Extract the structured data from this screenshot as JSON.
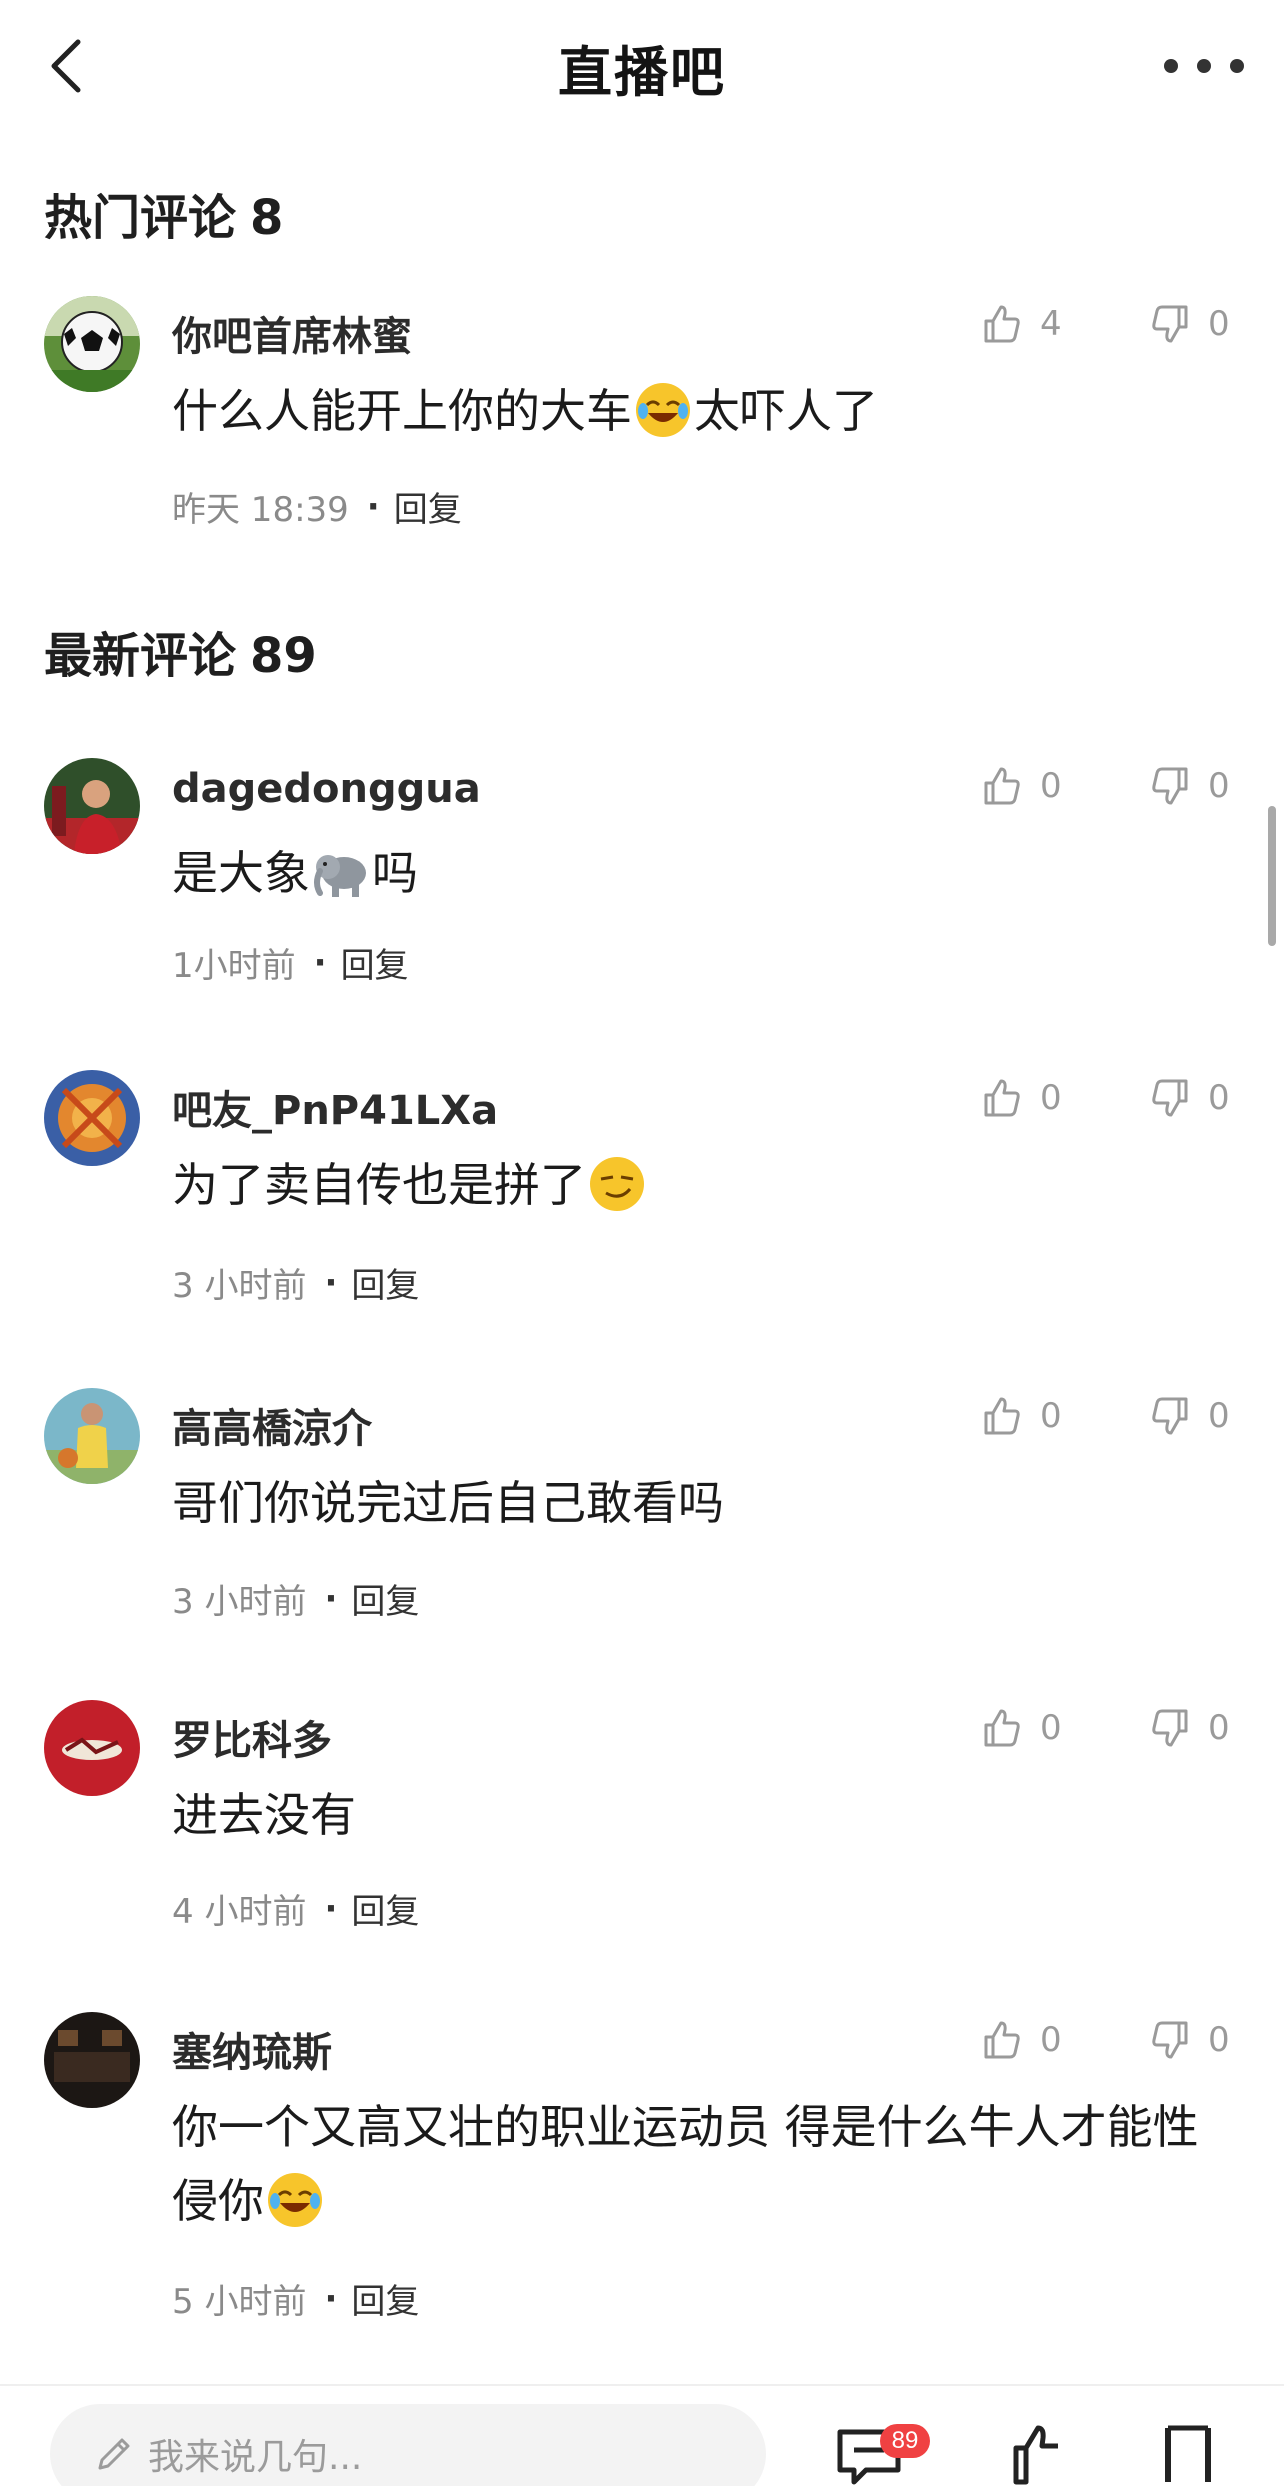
{
  "header": {
    "title": "直播吧",
    "back_icon": "chevron-left-icon",
    "more_icon": "more-dots-icon"
  },
  "hot_section": {
    "label": "热门评论",
    "count": "8"
  },
  "latest_section": {
    "label": "最新评论",
    "count": "89"
  },
  "hot_comments": [
    {
      "user": "你吧首席林蜜",
      "text_before": "什么人能开上你的大车",
      "emoji": "laugh-cry-emoji",
      "text_after": "太吓人了",
      "time": "昨天 18:39",
      "reply": "回复",
      "likes": "4",
      "dislikes": "0",
      "avatar": "soccer-ball-avatar"
    }
  ],
  "latest_comments": [
    {
      "user": "dagedonggua",
      "text_before": "是大象",
      "emoji": "elephant-emoji",
      "text_after": "吗",
      "time": "1小时前",
      "reply": "回复",
      "likes": "0",
      "dislikes": "0",
      "avatar": "player-red-avatar"
    },
    {
      "user": "吧友_PnP41LXa",
      "text_before": "为了卖自传也是拼了",
      "emoji": "smirk-emoji",
      "text_after": "",
      "time": "3 小时前",
      "reply": "回复",
      "likes": "0",
      "dislikes": "0",
      "avatar": "orange-abstract-avatar"
    },
    {
      "user": "高高橋涼介",
      "text_before": "哥们你说完过后自己敢看吗",
      "emoji": "",
      "text_after": "",
      "time": "3 小时前",
      "reply": "回复",
      "likes": "0",
      "dislikes": "0",
      "avatar": "basketball-player-avatar"
    },
    {
      "user": "罗比科多",
      "text_before": "进去没有",
      "emoji": "",
      "text_after": "",
      "time": "4 小时前",
      "reply": "回复",
      "likes": "0",
      "dislikes": "0",
      "avatar": "red-logo-avatar"
    },
    {
      "user": "塞纳琉斯",
      "text_before": "你一个又高又壮的职业运动员 得是什么牛人才能性侵你",
      "emoji": "laugh-cry-emoji",
      "text_after": "",
      "time": "5 小时前",
      "reply": "回复",
      "likes": "0",
      "dislikes": "0",
      "avatar": "dark-room-avatar"
    }
  ],
  "bottom_bar": {
    "input_placeholder": "我来说几句...",
    "comment_count_badge": "89",
    "icons": [
      "pencil-icon",
      "comment-icon",
      "like-icon",
      "bookmark-icon"
    ]
  },
  "colors": {
    "badge": "#f04142",
    "text_secondary": "#8a8a8a",
    "icon_gray": "#9a9a9a"
  }
}
